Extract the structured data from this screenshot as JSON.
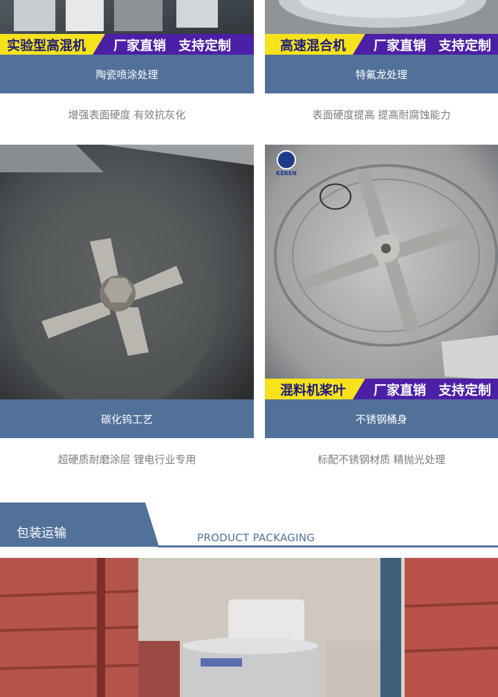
{
  "cards": [
    {
      "banner_left": "实验型高混机",
      "banner_right": [
        "厂家直销",
        "支持定制"
      ],
      "title": "陶瓷喷涂处理",
      "desc": "增强表面硬度 有效抗灰化"
    },
    {
      "banner_left": "高速混合机",
      "banner_right": [
        "厂家直销",
        "支持定制"
      ],
      "title": "特氟龙处理",
      "desc": "表面硬度提高 提高耐腐蚀能力"
    },
    {
      "title": "碳化钨工艺",
      "desc": "超硬质耐磨涂层 锂电行业专用"
    },
    {
      "logo_text": "KEREN",
      "banner_left": "混料机桨叶",
      "banner_right": [
        "厂家直销",
        "支持定制"
      ],
      "title": "不锈钢桶身",
      "desc": "标配不锈钢材质 精抛光处理"
    }
  ],
  "section": {
    "title_cn": "包装运输",
    "title_en": "PRODUCT PACKAGING"
  },
  "colors": {
    "accent": "#51719a",
    "banner_yellow": "#f7e21c",
    "banner_purple": "#4b1fa6"
  }
}
